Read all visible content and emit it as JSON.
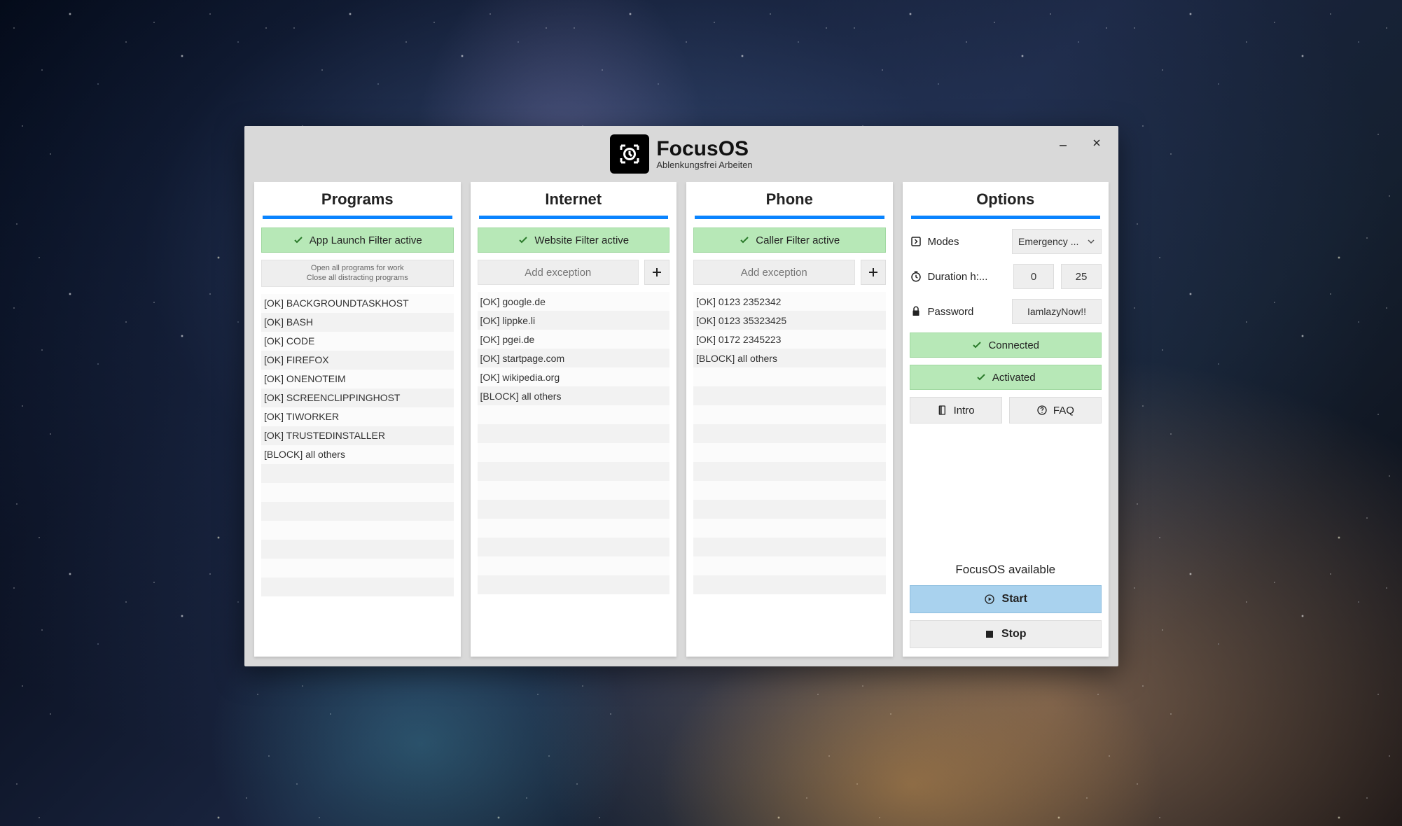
{
  "app": {
    "title": "FocusOS",
    "subtitle": "Ablenkungsfrei Arbeiten"
  },
  "panels": {
    "programs": {
      "title": "Programs",
      "status": "App Launch Filter active",
      "hint_line1": "Open all programs for work",
      "hint_line2": "Close all distracting programs",
      "items": [
        "[OK] BACKGROUNDTASKHOST",
        "[OK] BASH",
        "[OK] CODE",
        "[OK] FIREFOX",
        "[OK] ONENOTEIM",
        "[OK] SCREENCLIPPINGHOST",
        "[OK] TIWORKER",
        "[OK] TRUSTEDINSTALLER",
        "[BLOCK] all others"
      ]
    },
    "internet": {
      "title": "Internet",
      "status": "Website Filter active",
      "add_placeholder": "Add exception",
      "items": [
        "[OK] google.de",
        "[OK] lippke.li",
        "[OK] pgei.de",
        "[OK] startpage.com",
        "[OK] wikipedia.org",
        "[BLOCK] all others"
      ]
    },
    "phone": {
      "title": "Phone",
      "status": "Caller Filter active",
      "add_placeholder": "Add exception",
      "items": [
        "[OK] 0123 2352342",
        "[OK] 0123 35323425",
        "[OK] 0172 2345223",
        "[BLOCK] all others"
      ]
    },
    "options": {
      "title": "Options",
      "modes_label": "Modes",
      "modes_value": "Emergency ...",
      "duration_label": "Duration h:...",
      "duration_h": "0",
      "duration_m": "25",
      "password_label": "Password",
      "password_value": "IamlazyNow!!",
      "connected": "Connected",
      "activated": "Activated",
      "intro": "Intro",
      "faq": "FAQ",
      "available": "FocusOS available",
      "start": "Start",
      "stop": "Stop"
    }
  }
}
